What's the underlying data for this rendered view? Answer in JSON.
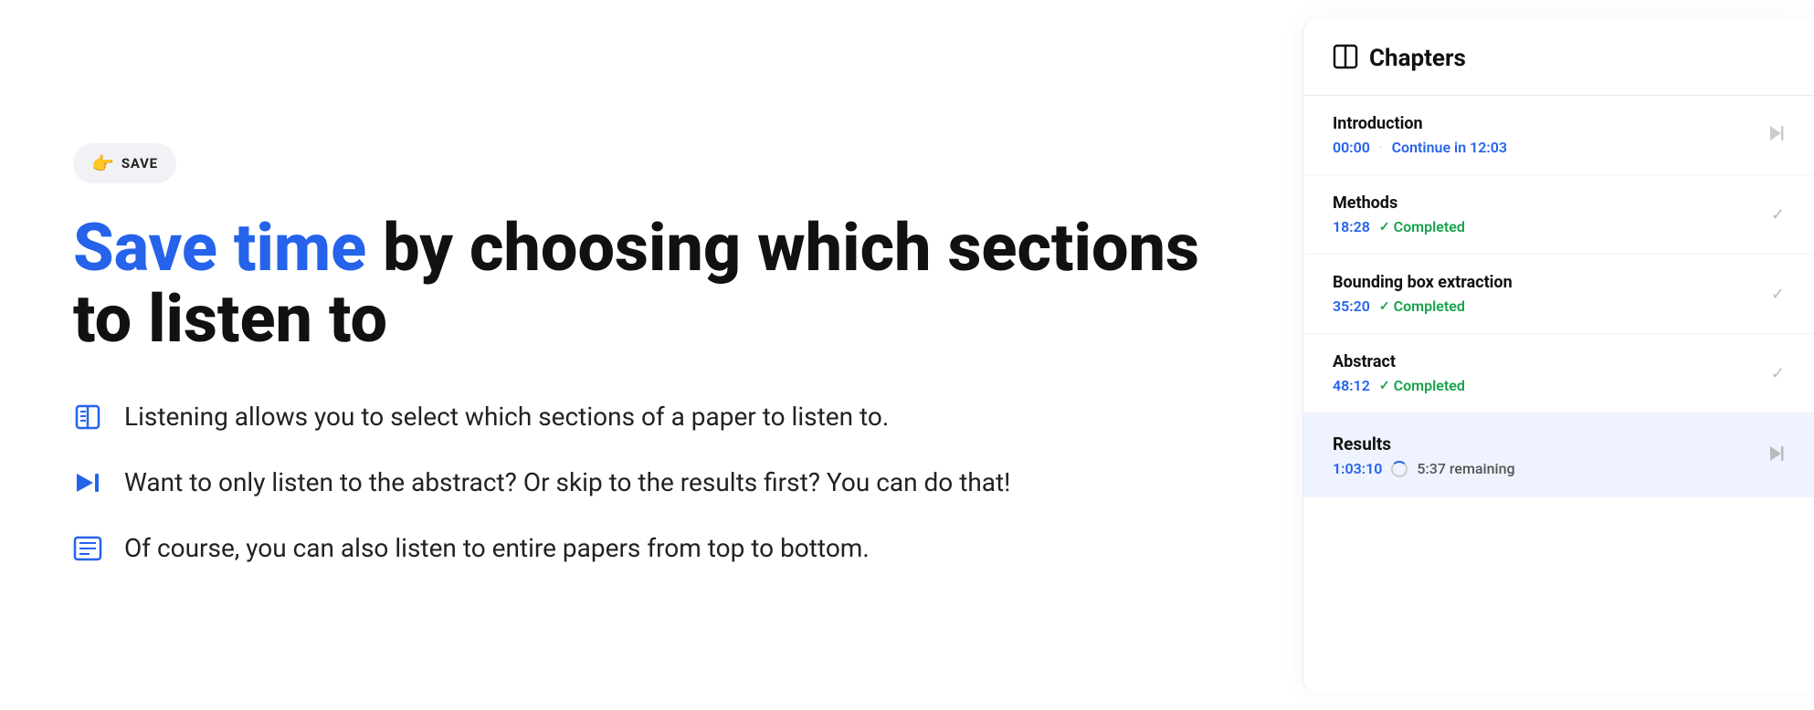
{
  "save_badge": {
    "icon": "👉",
    "label": "SAVE"
  },
  "headline": {
    "highlight": "Save time",
    "rest": " by choosing which sections to listen to"
  },
  "features": [
    {
      "icon": "book",
      "text": "Listening allows you to select which sections of a paper to listen to."
    },
    {
      "icon": "skip",
      "text": "Want to only listen to the abstract? Or skip to the results first? You can do that!"
    },
    {
      "icon": "list",
      "text": "Of course, you can also listen to entire papers from top to bottom."
    }
  ],
  "chapters": {
    "title": "Chapters",
    "items": [
      {
        "name": "Introduction",
        "time": "00:00",
        "status": "continue",
        "status_text": "Continue in 12:03",
        "action": "skip"
      },
      {
        "name": "Methods",
        "time": "18:28",
        "status": "completed",
        "status_text": "Completed",
        "action": "check"
      },
      {
        "name": "Bounding box extraction",
        "time": "35:20",
        "status": "completed",
        "status_text": "Completed",
        "action": "check"
      },
      {
        "name": "Abstract",
        "time": "48:12",
        "status": "completed",
        "status_text": "Completed",
        "action": "check"
      },
      {
        "name": "Results",
        "time": "1:03:10",
        "status": "remaining",
        "status_text": "5:37 remaining",
        "action": "skip",
        "highlighted": true
      }
    ]
  }
}
